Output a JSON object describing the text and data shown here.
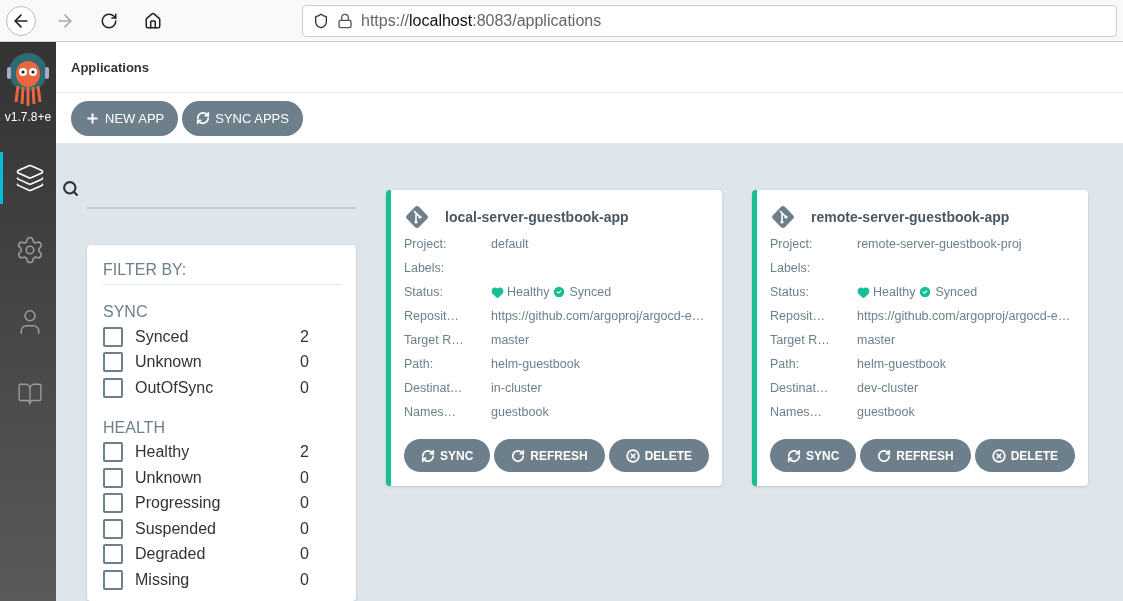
{
  "browser": {
    "url_scheme": "https://",
    "url_host": "localhost",
    "url_rest": ":8083/applications"
  },
  "sidebar": {
    "version": "v1.7.8+e",
    "items": [
      {
        "kind": "applications",
        "selected": true
      },
      {
        "kind": "settings",
        "selected": false
      },
      {
        "kind": "user",
        "selected": false
      },
      {
        "kind": "docs",
        "selected": false
      }
    ]
  },
  "header": {
    "title": "Applications"
  },
  "toolbar": {
    "buttons": [
      {
        "kind": "new",
        "label": "NEW APP"
      },
      {
        "kind": "sync",
        "label": "SYNC APPS"
      }
    ]
  },
  "filter": {
    "title": "FILTER BY:",
    "groups": [
      {
        "title": "SYNC",
        "items": [
          {
            "label": "Synced",
            "count": "2",
            "checked": false
          },
          {
            "label": "Unknown",
            "count": "0",
            "checked": false
          },
          {
            "label": "OutOfSync",
            "count": "0",
            "checked": false
          }
        ]
      },
      {
        "title": "HEALTH",
        "items": [
          {
            "label": "Healthy",
            "count": "2",
            "checked": false
          },
          {
            "label": "Unknown",
            "count": "0",
            "checked": false
          },
          {
            "label": "Progressing",
            "count": "0",
            "checked": false
          },
          {
            "label": "Suspended",
            "count": "0",
            "checked": false
          },
          {
            "label": "Degraded",
            "count": "0",
            "checked": false
          },
          {
            "label": "Missing",
            "count": "0",
            "checked": false
          }
        ]
      }
    ]
  },
  "apps": [
    {
      "name": "local-server-guestbook-app",
      "color": "#18be94",
      "fields": [
        {
          "label": "Project:",
          "value": "default"
        },
        {
          "label": "Labels:"
        },
        {
          "label": "Status:",
          "kind": "status",
          "health": "Healthy",
          "sync": "Synced"
        },
        {
          "label": "Reposit…",
          "value": "https://github.com/argoproj/argocd-e…"
        },
        {
          "label": "Target R…",
          "value": "master"
        },
        {
          "label": "Path:",
          "value": "helm-guestbook"
        },
        {
          "label": "Destinat…",
          "value": "in-cluster"
        },
        {
          "label": "Names…",
          "value": "guestbook"
        }
      ],
      "buttons": [
        {
          "kind": "sync",
          "label": "SYNC"
        },
        {
          "kind": "refresh",
          "label": "REFRESH"
        },
        {
          "kind": "delete",
          "label": "DELETE"
        }
      ]
    },
    {
      "name": "remote-server-guestbook-app",
      "color": "#18be94",
      "fields": [
        {
          "label": "Project:",
          "value": "remote-server-guestbook-proj"
        },
        {
          "label": "Labels:"
        },
        {
          "label": "Status:",
          "kind": "status",
          "health": "Healthy",
          "sync": "Synced"
        },
        {
          "label": "Reposit…",
          "value": "https://github.com/argoproj/argocd-e…"
        },
        {
          "label": "Target R…",
          "value": "master"
        },
        {
          "label": "Path:",
          "value": "helm-guestbook"
        },
        {
          "label": "Destinat…",
          "value": "dev-cluster"
        },
        {
          "label": "Names…",
          "value": "guestbook"
        }
      ],
      "buttons": [
        {
          "kind": "sync",
          "label": "SYNC"
        },
        {
          "kind": "refresh",
          "label": "REFRESH"
        },
        {
          "kind": "delete",
          "label": "DELETE"
        }
      ]
    }
  ]
}
